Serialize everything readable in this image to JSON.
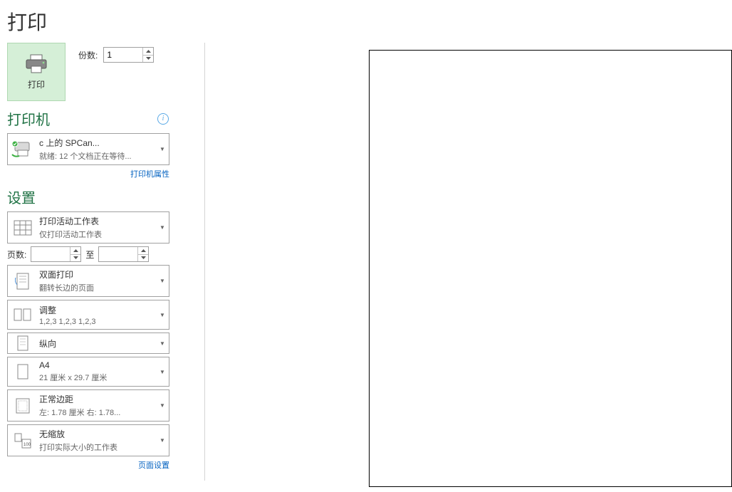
{
  "page_title": "打印",
  "print": {
    "button_label": "打印",
    "copies_label": "份数:",
    "copies_value": "1"
  },
  "printer": {
    "section_title": "打印机",
    "name": "c                   上的  SPCan...",
    "status": "就绪: 12 个文档正在等待...",
    "properties_link": "打印机属性"
  },
  "settings": {
    "section_title": "设置",
    "print_what": {
      "title": "打印活动工作表",
      "sub": "仅打印活动工作表"
    },
    "pages_label": "页数:",
    "pages_to": "至",
    "duplex": {
      "title": "双面打印",
      "sub": "翻转长边的页面"
    },
    "collate": {
      "title": "调整",
      "sub": "1,2,3    1,2,3    1,2,3"
    },
    "orientation": {
      "title": "纵向"
    },
    "paper": {
      "title": "A4",
      "sub": "21 厘米 x 29.7 厘米"
    },
    "margins": {
      "title": "正常边距",
      "sub": "左: 1.78 厘米   右: 1.78..."
    },
    "scaling": {
      "title": "无缩放",
      "sub": "打印实际大小的工作表"
    },
    "page_setup_link": "页面设置"
  }
}
